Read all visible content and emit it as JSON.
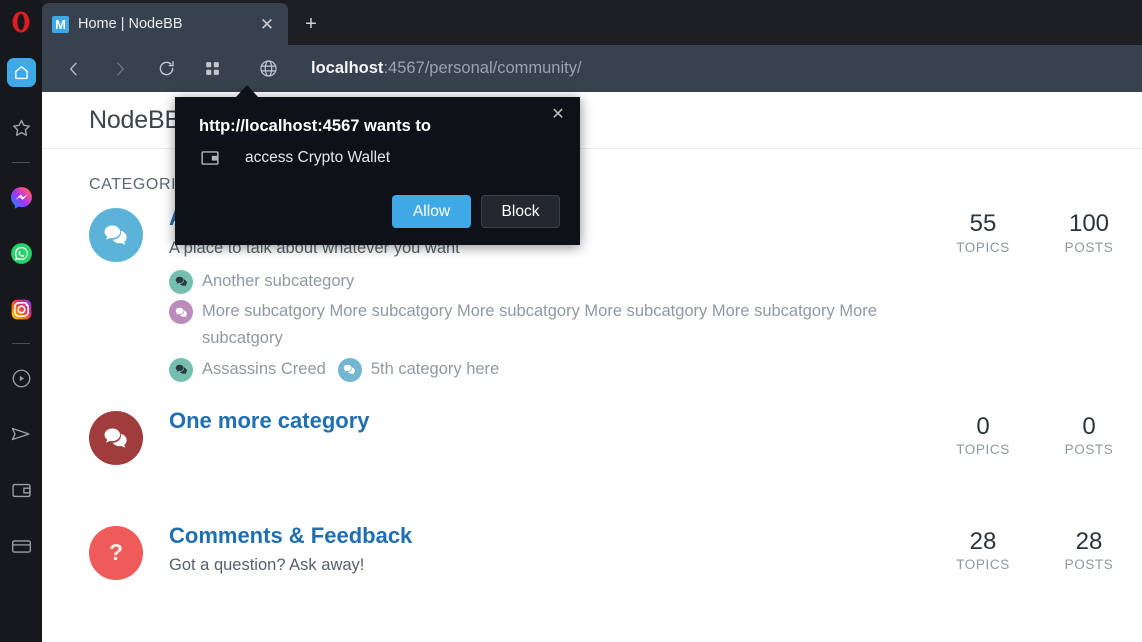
{
  "browser": {
    "name": "Opera",
    "tab": {
      "title": "Home | NodeBB",
      "favicon_letter": "M",
      "favicon_color": "#3fa9e8"
    },
    "new_tab_label": "+",
    "close_tab_label": "✕",
    "toolbar": {
      "back_icon": "back-arrow-icon",
      "forward_icon": "forward-arrow-icon",
      "reload_icon": "reload-icon",
      "speeddial_icon": "grid-icon",
      "site_info_icon": "globe-icon",
      "url_host": "localhost",
      "url_rest": ":4567/personal/community/",
      "url_full": "localhost:4567/personal/community/"
    },
    "sidebar": [
      {
        "name": "home",
        "icon": "home-icon",
        "active": true,
        "color": "#3fa9e8"
      },
      {
        "name": "favorites",
        "icon": "star-icon",
        "active": false,
        "color": "#9aa0aa"
      },
      {
        "name": "divider-1",
        "icon": "divider",
        "active": false,
        "color": "#4a4c52"
      },
      {
        "name": "messenger",
        "icon": "messenger-icon",
        "active": false,
        "color": "#a033fe"
      },
      {
        "name": "whatsapp",
        "icon": "whatsapp-icon",
        "active": false,
        "color": "#25d366"
      },
      {
        "name": "instagram",
        "icon": "instagram-icon",
        "active": false,
        "color": "#e1306c"
      },
      {
        "name": "divider-2",
        "icon": "divider",
        "active": false,
        "color": "#4a4c52"
      },
      {
        "name": "player",
        "icon": "play-circle-icon",
        "active": false,
        "color": "#9aa0aa"
      },
      {
        "name": "telegram",
        "icon": "send-icon",
        "active": false,
        "color": "#9aa0aa"
      },
      {
        "name": "crypto-wallet",
        "icon": "wallet-icon",
        "active": false,
        "color": "#9aa0aa"
      },
      {
        "name": "card",
        "icon": "credit-card-icon",
        "active": false,
        "color": "#9aa0aa"
      }
    ]
  },
  "dialog": {
    "title": "http://localhost:4567 wants to",
    "permission": "access Crypto Wallet",
    "icon": "wallet-icon",
    "close_label": "✕",
    "allow_label": "Allow",
    "block_label": "Block",
    "allow_color": "#3fa9e8",
    "block_color": "#232830"
  },
  "page": {
    "title": "NodeBB",
    "section_heading": "CATEGORIES",
    "stat_labels": {
      "topics": "TOPICS",
      "posts": "POSTS"
    },
    "categories": [
      {
        "name": "Assassin's Creed",
        "description": "A place to talk about whatever you want",
        "avatar_color": "#5cb3d9",
        "avatar_icon": "comments-icon",
        "avatar_glyph": "",
        "topics": "55",
        "posts": "100",
        "subcategories": [
          {
            "label": "Another subcategory",
            "color": "#76bfb0",
            "glyph_color": "#2b3a42"
          },
          {
            "label": "More subcatgory More subcatgory More subcatgory More subcatgory More subcatgory More subcatgory",
            "color": "#bb8cbb",
            "glyph_color": "#ffffff"
          },
          {
            "label": "Assassins Creed",
            "color": "#76bfb0",
            "glyph_color": "#2b3a42"
          },
          {
            "label": "5th category here",
            "color": "#73b6d2",
            "glyph_color": "#ffffff"
          }
        ]
      },
      {
        "name": "One more category",
        "description": "",
        "avatar_color": "#a03c3c",
        "avatar_icon": "comments-icon",
        "avatar_glyph": "",
        "topics": "0",
        "posts": "0",
        "subcategories": []
      },
      {
        "name": "Comments & Feedback",
        "description": "Got a question? Ask away!",
        "avatar_color": "#ef5b5b",
        "avatar_icon": "question-mark-icon",
        "avatar_glyph": "?",
        "topics": "28",
        "posts": "28",
        "subcategories": []
      }
    ]
  }
}
